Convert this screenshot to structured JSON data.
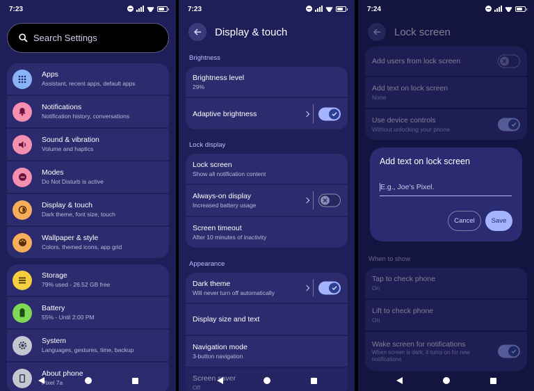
{
  "status_bars": [
    {
      "time": "7:23"
    },
    {
      "time": "7:23"
    },
    {
      "time": "7:24"
    }
  ],
  "settings": {
    "search_placeholder": "Search Settings",
    "group1": [
      {
        "title": "Apps",
        "subtitle": "Assistant, recent apps, default apps",
        "icon": "apps-grid-icon",
        "color": "#8ab4f8"
      },
      {
        "title": "Notifications",
        "subtitle": "Notification history, conversations",
        "icon": "bell-icon",
        "color": "#f48fb1"
      },
      {
        "title": "Sound & vibration",
        "subtitle": "Volume and haptics",
        "icon": "speaker-icon",
        "color": "#f48fb1"
      },
      {
        "title": "Modes",
        "subtitle": "Do Not Disturb is active",
        "icon": "dnd-icon",
        "color": "#f48fb1"
      },
      {
        "title": "Display & touch",
        "subtitle": "Dark theme, font size, touch",
        "icon": "display-icon",
        "color": "#f6ad5a"
      },
      {
        "title": "Wallpaper & style",
        "subtitle": "Colors, themed icons, app grid",
        "icon": "palette-icon",
        "color": "#f6ad5a"
      }
    ],
    "group2": [
      {
        "title": "Storage",
        "subtitle": "79% used - 26.52 GB free",
        "icon": "storage-icon",
        "color": "#f4d03f"
      },
      {
        "title": "Battery",
        "subtitle": "55% - Until 2:00 PM",
        "icon": "battery-icon",
        "color": "#7ed957"
      },
      {
        "title": "System",
        "subtitle": "Languages, gestures, time, backup",
        "icon": "gear-icon",
        "color": "#c6c6d0"
      },
      {
        "title": "About phone",
        "subtitle": "Pixel 7a",
        "icon": "phone-icon",
        "color": "#c6c6d0"
      }
    ]
  },
  "display": {
    "title": "Display & touch",
    "sections": {
      "brightness": "Brightness",
      "lock_display": "Lock display",
      "appearance": "Appearance"
    },
    "brightness_level": {
      "title": "Brightness level",
      "subtitle": "29%"
    },
    "adaptive_brightness": {
      "title": "Adaptive brightness",
      "enabled": true
    },
    "lock_screen": {
      "title": "Lock screen",
      "subtitle": "Show all notification content"
    },
    "always_on": {
      "title": "Always-on display",
      "subtitle": "Increased battery usage",
      "enabled": false
    },
    "screen_timeout": {
      "title": "Screen timeout",
      "subtitle": "After 10 minutes of inactivity"
    },
    "dark_theme": {
      "title": "Dark theme",
      "subtitle": "Will never turn off automatically",
      "enabled": true
    },
    "display_size": {
      "title": "Display size and text"
    },
    "navigation_mode": {
      "title": "Navigation mode",
      "subtitle": "3-button navigation"
    },
    "screen_saver": {
      "title": "Screen saver",
      "subtitle": "Off"
    }
  },
  "lockscreen": {
    "title": "Lock screen",
    "add_users": {
      "title": "Add users from lock screen",
      "enabled": false
    },
    "add_text": {
      "title": "Add text on lock screen",
      "subtitle": "None"
    },
    "device_controls": {
      "title": "Use device controls",
      "subtitle": "Without unlocking your phone",
      "enabled": true
    },
    "when_to_show": "When to show",
    "tap_check": {
      "title": "Tap to check phone",
      "subtitle": "On"
    },
    "lift_check": {
      "title": "Lift to check phone",
      "subtitle": "On"
    },
    "wake_screen": {
      "title": "Wake screen for notifications",
      "subtitle": "When screen is dark, it turns on for new notifications",
      "enabled": true
    }
  },
  "dialog": {
    "title": "Add text on lock screen",
    "placeholder": "E.g., Joe’s Pixel.",
    "cancel": "Cancel",
    "save": "Save"
  },
  "colors": {
    "bg": "#1e1e58",
    "card": "#2b2b6e",
    "accent": "#a5b4ff",
    "section": "#b6c0ff"
  }
}
